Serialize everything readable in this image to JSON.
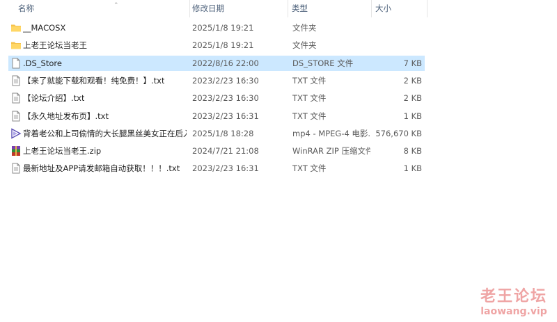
{
  "columns": {
    "name": "名称",
    "date": "修改日期",
    "type": "类型",
    "size": "大小"
  },
  "files": [
    {
      "name": "__MACOSX",
      "date": "2025/1/8 19:21",
      "type": "文件夹",
      "size": "",
      "icon": "folder-icon",
      "selected": false
    },
    {
      "name": "上老王论坛当老王",
      "date": "2025/1/8 19:21",
      "type": "文件夹",
      "size": "",
      "icon": "folder-icon",
      "selected": false
    },
    {
      "name": ".DS_Store",
      "date": "2022/8/16 22:00",
      "type": "DS_STORE 文件",
      "size": "7 KB",
      "icon": "file-icon",
      "selected": true
    },
    {
      "name": "【来了就能下载和观看！纯免费！】.txt",
      "date": "2023/2/23 16:30",
      "type": "TXT 文件",
      "size": "2 KB",
      "icon": "text-file-icon",
      "selected": false
    },
    {
      "name": "【论坛介绍】.txt",
      "date": "2023/2/23 16:30",
      "type": "TXT 文件",
      "size": "2 KB",
      "icon": "text-file-icon",
      "selected": false
    },
    {
      "name": "【永久地址发布页】.txt",
      "date": "2023/2/23 16:31",
      "type": "TXT 文件",
      "size": "1 KB",
      "icon": "text-file-icon",
      "selected": false
    },
    {
      "name": "背着老公和上司偷情的大长腿黑丝美女正在后入...",
      "date": "2025/1/8 18:28",
      "type": "mp4 - MPEG-4 电影...",
      "size": "576,670 KB",
      "icon": "video-file-icon",
      "selected": false
    },
    {
      "name": "上老王论坛当老王.zip",
      "date": "2024/7/21 21:08",
      "type": "WinRAR ZIP 压缩文件",
      "size": "8 KB",
      "icon": "winrar-icon",
      "selected": false
    },
    {
      "name": "最新地址及APP请发邮箱自动获取！！！.txt",
      "date": "2023/2/23 16:31",
      "type": "TXT 文件",
      "size": "1 KB",
      "icon": "text-file-icon",
      "selected": false
    }
  ],
  "watermark": {
    "title": "老王论坛",
    "url": "laowang.vip"
  },
  "colors": {
    "selection": "#cce8ff",
    "folder": "#f5c24d",
    "watermark": "#e25a5a"
  }
}
